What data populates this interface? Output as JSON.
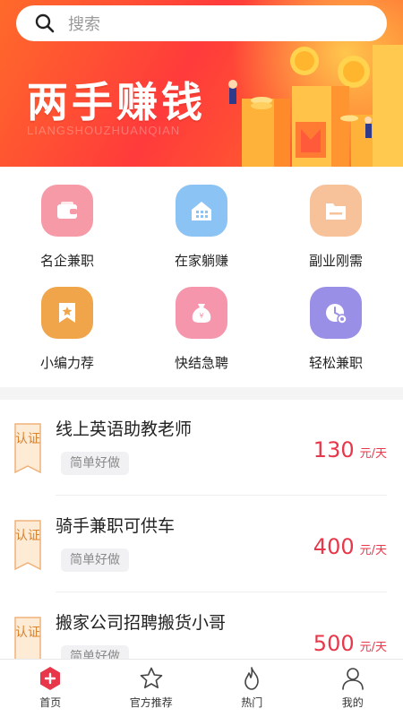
{
  "search": {
    "placeholder": "搜索",
    "icon": "search-icon"
  },
  "banner": {
    "title": "两手赚钱",
    "subtitle": "LIANGSHOUZHUANQIAN"
  },
  "categories": [
    {
      "label": "名企兼职",
      "icon": "wallet-icon",
      "color": "#f79aa8"
    },
    {
      "label": "在家躺赚",
      "icon": "house-icon",
      "color": "#8cc3f5"
    },
    {
      "label": "副业刚需",
      "icon": "folder-icon",
      "color": "#f7c19a"
    },
    {
      "label": "小编力荐",
      "icon": "bookmark-star-icon",
      "color": "#f0a54a"
    },
    {
      "label": "快结急聘",
      "icon": "money-bag-icon",
      "color": "#f596ad"
    },
    {
      "label": "轻松兼职",
      "icon": "clock-icon",
      "color": "#9a8fe6"
    }
  ],
  "jobs": [
    {
      "badge": "认证",
      "title": "线上英语助教老师",
      "tag": "简单好做",
      "price": "130",
      "unit": "元/天"
    },
    {
      "badge": "认证",
      "title": "骑手兼职可供车",
      "tag": "简单好做",
      "price": "400",
      "unit": "元/天"
    },
    {
      "badge": "认证",
      "title": "搬家公司招聘搬货小哥",
      "tag": "简单好做",
      "price": "500",
      "unit": "元/天"
    }
  ],
  "tabs": [
    {
      "label": "首页",
      "icon": "home-hexagon-icon",
      "active": true
    },
    {
      "label": "官方推荐",
      "icon": "star-icon",
      "active": false
    },
    {
      "label": "热门",
      "icon": "flame-icon",
      "active": false
    },
    {
      "label": "我的",
      "icon": "user-icon",
      "active": false
    }
  ],
  "colors": {
    "accent": "#e8374a",
    "badge": "#d9822b",
    "banner": "#ff4a30"
  }
}
